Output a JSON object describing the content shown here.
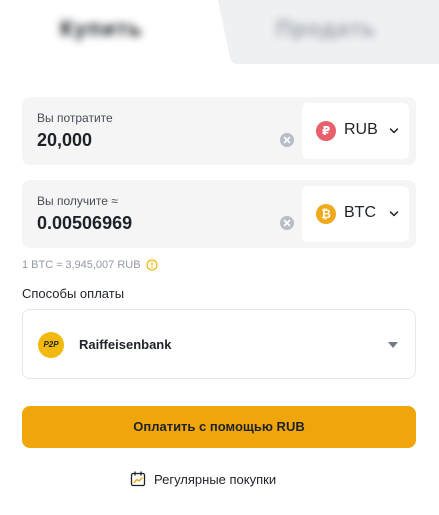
{
  "tabs": {
    "buy_label": "Купить",
    "sell_label": "Продать"
  },
  "spend": {
    "label": "Вы потратите",
    "value": "20,000",
    "currency": "RUB",
    "coin_symbol": "₽",
    "coin_color": "#e8606a"
  },
  "receive": {
    "label": "Вы получите ≈",
    "value": "0.00506969",
    "currency": "BTC",
    "coin_symbol": "₿",
    "coin_color": "#f0a91b"
  },
  "rate": {
    "text": "1 BTC ≈ 3,945,007 RUB"
  },
  "payment": {
    "title": "Способы оплаты",
    "method_badge": "P2P",
    "method_name": "Raiffeisenbank"
  },
  "actions": {
    "pay_label": "Оплатить с помощью RUB",
    "recurring_label": "Регулярные покупки"
  },
  "colors": {
    "accent": "#f0a60b",
    "panel_bg": "#f5f5f5"
  }
}
